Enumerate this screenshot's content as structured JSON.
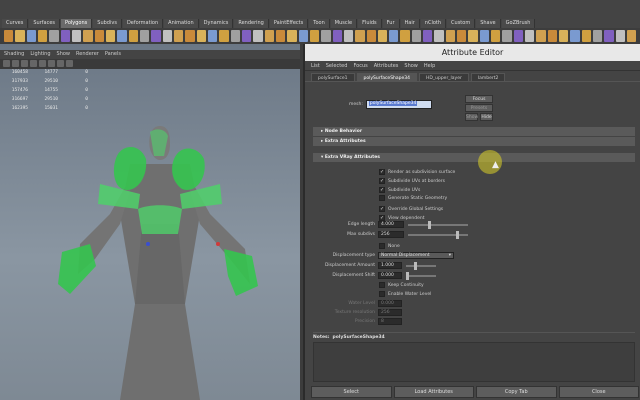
{
  "shelf_tabs": [
    "Curves",
    "Surfaces",
    "Polygons",
    "Subdivs",
    "Deformation",
    "Animation",
    "Dynamics",
    "Rendering",
    "PaintEffects",
    "Toon",
    "Muscle",
    "Fluids",
    "Fur",
    "Hair",
    "nCloth",
    "Custom",
    "Shave",
    "GoZBrush"
  ],
  "shelf_active": "Polygons",
  "viewport": {
    "menu": [
      "Shading",
      "Lighting",
      "Show",
      "Renderer",
      "Panels"
    ],
    "stats": [
      [
        "160458",
        "14777",
        "0"
      ],
      [
        "317933",
        "29510",
        "0"
      ],
      [
        "157476",
        "14755",
        "0"
      ],
      [
        "316697",
        "29510",
        "0"
      ],
      [
        "162395",
        "15031",
        "0"
      ]
    ]
  },
  "attribute_editor": {
    "title": "Attribute Editor",
    "menu": [
      "List",
      "Selected",
      "Focus",
      "Attributes",
      "Show",
      "Help"
    ],
    "tabs": [
      "polySurface1",
      "polySurfaceShape34",
      "HD_upper_layer",
      "lambert2"
    ],
    "active_tab": "polySurfaceShape34",
    "mesh_label": "mesh:",
    "mesh_value": "polySurfaceShape34",
    "focus_btn": "Focus",
    "presets_btn": "Presets",
    "show_btn": "Show",
    "hide_btn": "Hide",
    "sections": {
      "node_behavior": "Node Behavior",
      "extra_attributes": "Extra Attributes",
      "extra_vray": "Extra VRay Attributes"
    },
    "checkboxes": [
      "Render as subdivision surface",
      "Subdivide UVs at borders",
      "Subdivide UVs",
      "Generate Static Geometry",
      "Override Global Settings",
      "View dependent"
    ],
    "checked": [
      true,
      true,
      true,
      false,
      true,
      true
    ],
    "edge_length_label": "Edge length",
    "edge_length_value": "4.000",
    "max_subdivs_label": "Max subdivs",
    "max_subdivs_value": "256",
    "none_label": "None",
    "displacement_type_label": "Displacement type",
    "displacement_type_value": "Normal Displacement",
    "displacement_amount_label": "Displacement Amount",
    "displacement_amount_value": "1.000",
    "displacement_shift_label": "Displacement Shift",
    "displacement_shift_value": "0.000",
    "keep_continuity": "Keep Continuity",
    "enable_water": "Enable Water Level",
    "water_level_label": "Water Level",
    "water_level_value": "0.000",
    "texture_resolution_label": "Texture resolution",
    "texture_resolution_value": "256",
    "precision_label": "Precision",
    "precision_value": "8",
    "notes_label": "Notes:",
    "notes_value": "polySurfaceShape34",
    "bottom_buttons": [
      "Select",
      "Load Attributes",
      "Copy Tab",
      "Close"
    ]
  },
  "colors": {
    "accent_selection": "#4fd16a",
    "ui_bg": "#444444",
    "viewport_bg": "#7e8994"
  }
}
